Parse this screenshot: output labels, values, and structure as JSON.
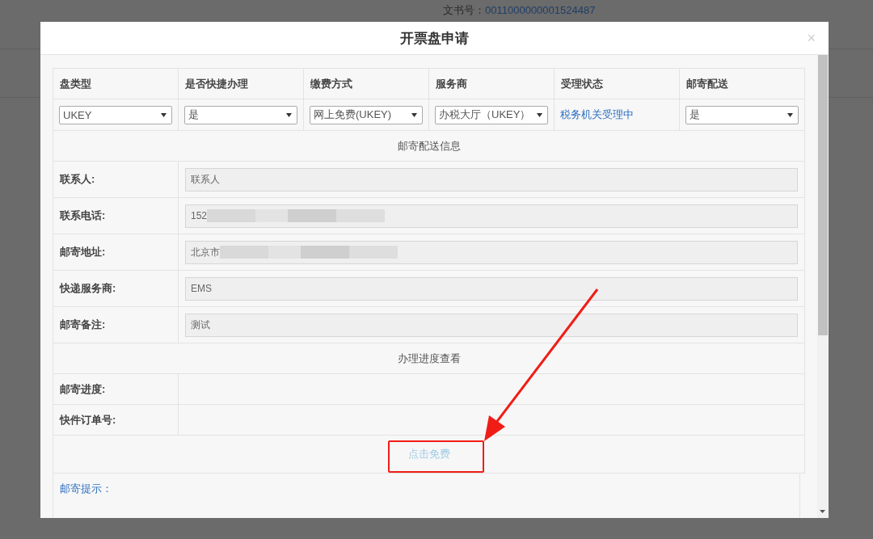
{
  "background": {
    "doc_label": "文书号：",
    "doc_number": "0011000000001524487"
  },
  "dialog": {
    "title": "开票盘申请",
    "close": "×"
  },
  "columns": [
    "盘类型",
    "是否快捷办理",
    "缴费方式",
    "服务商",
    "受理状态",
    "邮寄配送"
  ],
  "selections": [
    {
      "kind": "select",
      "value": "UKEY"
    },
    {
      "kind": "select",
      "value": "是"
    },
    {
      "kind": "select",
      "value": "网上免费(UKEY)"
    },
    {
      "kind": "select",
      "value": "办税大厅（UKEY）"
    },
    {
      "kind": "status",
      "value": "税务机关受理中"
    },
    {
      "kind": "select",
      "value": "是"
    }
  ],
  "shipping_section": {
    "title": "邮寄配送信息",
    "fields": [
      {
        "label": "联系人:",
        "value": "联系人",
        "redacted": false
      },
      {
        "label": "联系电话:",
        "value": "152",
        "redacted": true
      },
      {
        "label": "邮寄地址:",
        "value": "北京市",
        "redacted": true
      },
      {
        "label": "快递服务商:",
        "value": "EMS",
        "redacted": false
      },
      {
        "label": "邮寄备注:",
        "value": "测试",
        "redacted": false
      }
    ]
  },
  "progress_section": {
    "title": "办理进度查看",
    "fields": [
      {
        "label": "邮寄进度:"
      },
      {
        "label": "快件订单号:"
      }
    ]
  },
  "action": {
    "label": "点击免费",
    "disabled": true
  },
  "tip": {
    "label": "邮寄提示："
  },
  "annotation": {
    "kind": "arrow_and_box"
  }
}
